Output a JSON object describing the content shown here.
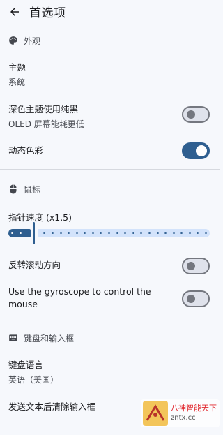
{
  "appbar": {
    "title": "首选项",
    "back_icon": "arrow-left-icon"
  },
  "sections": {
    "appearance": {
      "title": "外观",
      "icon": "palette-icon",
      "theme": {
        "title": "主题",
        "summary": "系统"
      },
      "pure_black": {
        "title": "深色主题使用纯黑",
        "summary": "OLED 屏幕能耗更低",
        "checked": false
      },
      "dynamic_color": {
        "title": "动态色彩",
        "checked": true
      }
    },
    "mouse": {
      "title": "鼠标",
      "icon": "mouse-icon",
      "pointer_speed": {
        "title": "指针速度 (x1.5)",
        "value": 1.5,
        "ticks": 25,
        "selected_index": 2
      },
      "invert_scroll": {
        "title": "反转滚动方向",
        "checked": false
      },
      "gyroscope": {
        "title": "Use the gyroscope to control the mouse",
        "checked": false
      }
    },
    "keyboard": {
      "title": "键盘和输入框",
      "icon": "keyboard-icon",
      "language": {
        "title": "键盘语言",
        "summary": "英语（美国）"
      },
      "clear_after_send": {
        "title": "发送文本后清除输入框"
      }
    }
  },
  "watermark": {
    "line1": "八神智能天下",
    "line2": "zntx.cc"
  },
  "colors": {
    "accent": "#2f5f90",
    "accent_container": "#d3e3fb",
    "background": "#f6f8fc",
    "outline": "#74777f"
  }
}
